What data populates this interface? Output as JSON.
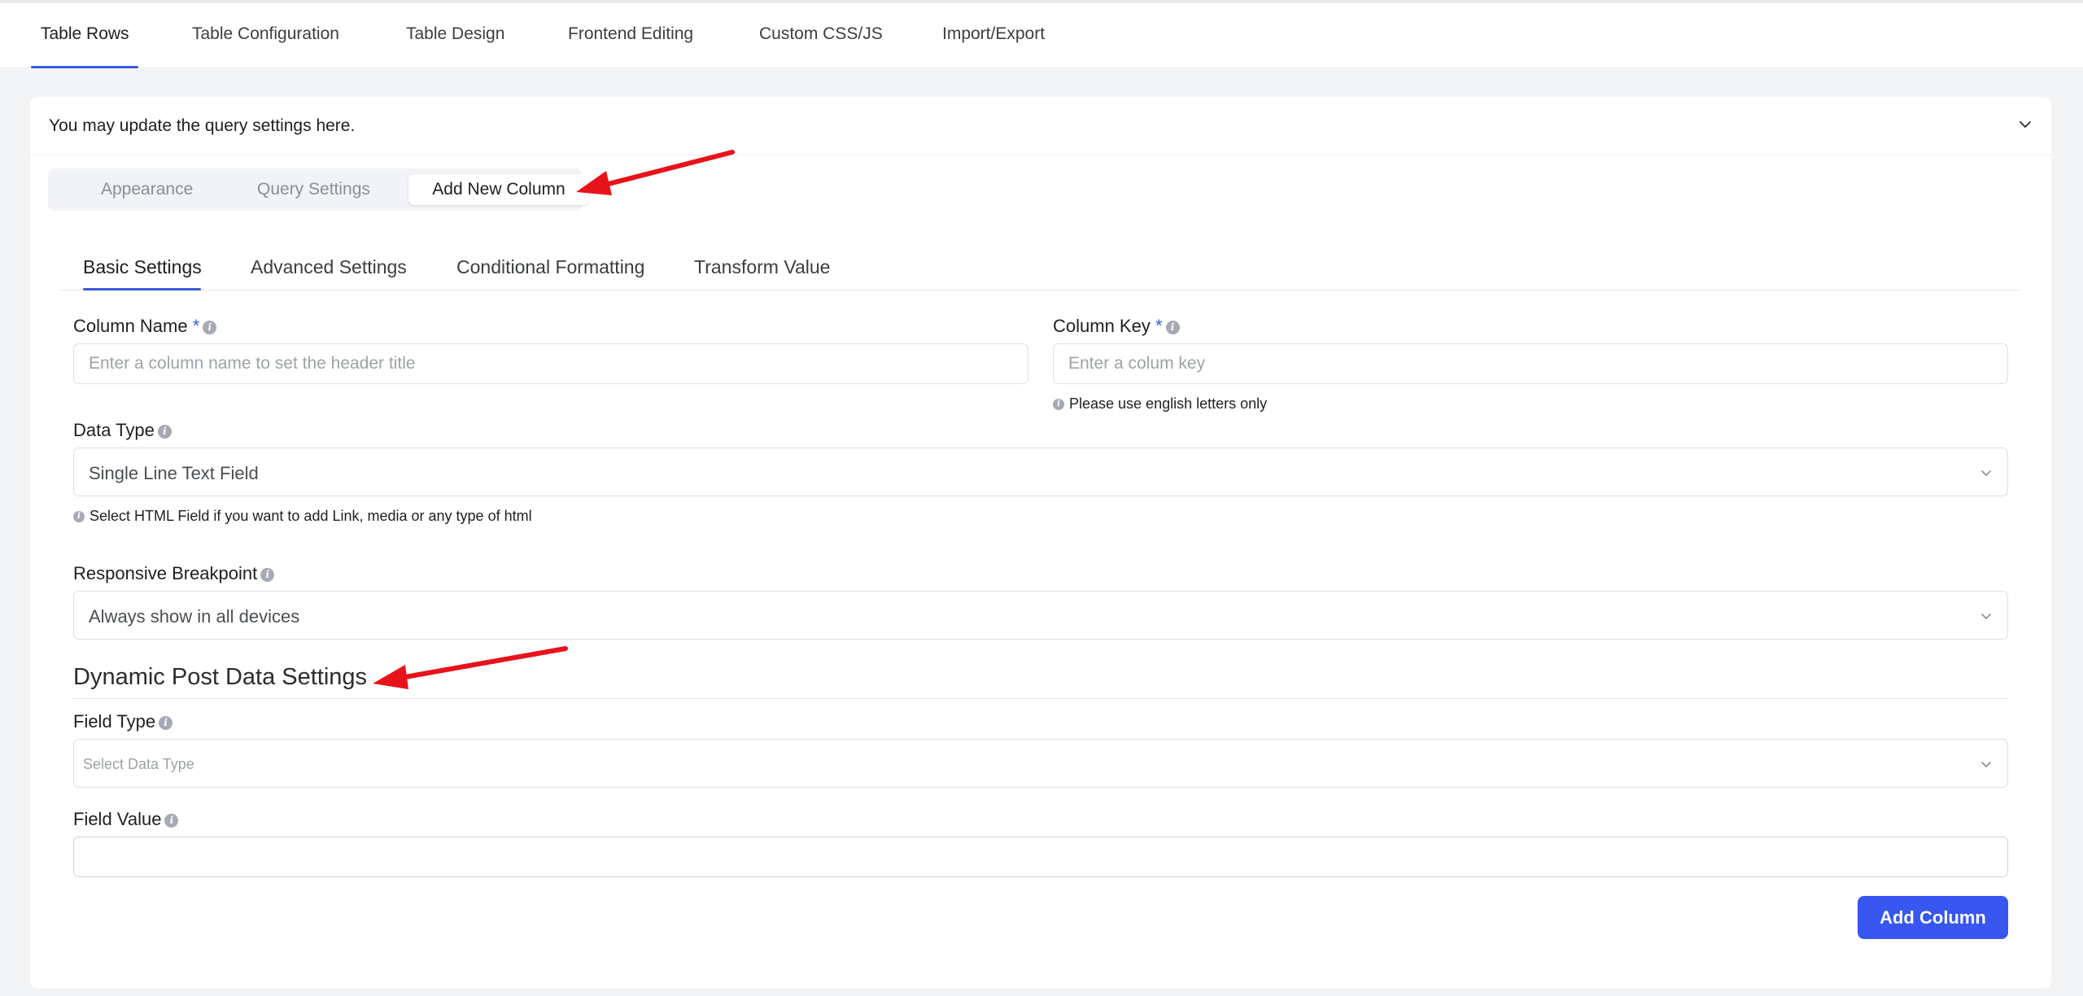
{
  "top_tabs": [
    {
      "label": "Table Rows",
      "active": true
    },
    {
      "label": "Table Configuration"
    },
    {
      "label": "Table Design"
    },
    {
      "label": "Frontend Editing"
    },
    {
      "label": "Custom CSS/JS"
    },
    {
      "label": "Import/Export"
    }
  ],
  "card": {
    "title": "You may update the query settings here.",
    "chevron_icon": "chevron-down-icon"
  },
  "segment_tabs": [
    {
      "label": "Appearance"
    },
    {
      "label": "Query Settings"
    },
    {
      "label": "Add New Column",
      "active": true
    }
  ],
  "sub_tabs": [
    {
      "label": "Basic Settings",
      "active": true
    },
    {
      "label": "Advanced Settings"
    },
    {
      "label": "Conditional Formatting"
    },
    {
      "label": "Transform Value"
    }
  ],
  "form": {
    "column_name": {
      "label": "Column Name",
      "required": "*",
      "placeholder": "Enter a column name to set the header title",
      "value": ""
    },
    "column_key": {
      "label": "Column Key",
      "required": "*",
      "placeholder": "Enter a colum key",
      "value": "",
      "help": "Please use english letters only"
    },
    "data_type": {
      "label": "Data Type",
      "value": "Single Line Text Field",
      "help": "Select HTML Field if you want to add Link, media or any type of html"
    },
    "responsive_breakpoint": {
      "label": "Responsive Breakpoint",
      "value": "Always show in all devices"
    },
    "dynamic_section": {
      "title": "Dynamic Post Data Settings"
    },
    "field_type": {
      "label": "Field Type",
      "placeholder": "Select Data Type"
    },
    "field_value": {
      "label": "Field Value",
      "value": ""
    },
    "submit_label": "Add Column"
  },
  "colors": {
    "accent": "#3856f0",
    "annotation_arrow": "#e8121b",
    "tab_underline": "#3b5bdb"
  }
}
